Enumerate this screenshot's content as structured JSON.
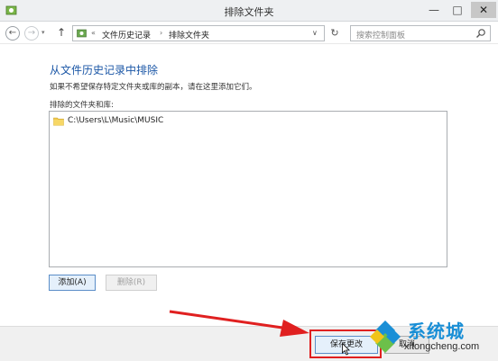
{
  "window": {
    "title": "排除文件夹",
    "minimize_glyph": "—",
    "maximize_glyph": "□",
    "close_glyph": "✕"
  },
  "nav": {
    "back_glyph": "←",
    "forward_glyph": "→",
    "dropdown_glyph": "▾",
    "up_glyph": "↑",
    "breadcrumb_chevron": "«",
    "breadcrumb": [
      "文件历史记录",
      "排除文件夹"
    ],
    "breadcrumb_separator": "›",
    "address_dropdown_glyph": "∨",
    "refresh_glyph": "↻",
    "search_placeholder": "搜索控制面板"
  },
  "content": {
    "heading": "从文件历史记录中排除",
    "description": "如果不希望保存特定文件夹或库的副本，请在这里添加它们。",
    "list_label": "排除的文件夹和库:",
    "items": [
      {
        "path": "C:\\Users\\L\\Music\\MUSIC",
        "icon": "folder-icon"
      }
    ],
    "add_button": "添加(A)",
    "remove_button": "删除(R)"
  },
  "footer": {
    "save_button": "保存更改",
    "cancel_button": "取消"
  },
  "watermark": {
    "brand": "系统城",
    "url": "xitongcheng.com"
  },
  "colors": {
    "heading": "#1a56a6",
    "highlight": "#e02020",
    "watermark": "#1a8fd6"
  }
}
